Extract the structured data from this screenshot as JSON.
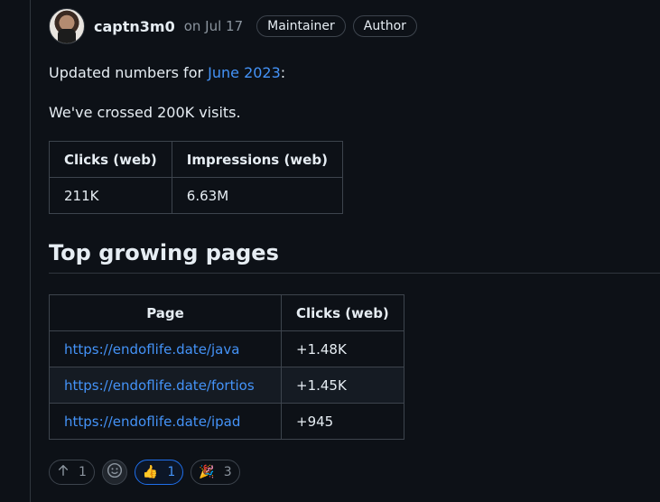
{
  "comment": {
    "author": "captn3m0",
    "date": "on Jul 17",
    "badges": [
      "Maintainer",
      "Author"
    ],
    "intro_prefix": "Updated numbers for ",
    "intro_link": "June 2023",
    "intro_suffix": ":",
    "crossed": "We've crossed 200K visits.",
    "stats": {
      "headers": [
        "Clicks (web)",
        "Impressions (web)"
      ],
      "row": [
        "211K",
        "6.63M"
      ]
    },
    "heading": "Top growing pages",
    "pages": {
      "headers": [
        "Page",
        "Clicks (web)"
      ],
      "rows": [
        [
          "https://endoflife.date/java",
          "+1.48K"
        ],
        [
          "https://endoflife.date/fortios",
          "+1.45K"
        ],
        [
          "https://endoflife.date/ipad",
          "+945"
        ]
      ]
    },
    "reactions": {
      "upvote_count": "1",
      "thumbs_count": "1",
      "tada_count": "3"
    }
  },
  "icons": [
    "arrow-up-icon",
    "smiley-icon",
    "thumbs-up-icon",
    "tada-icon"
  ],
  "colors": {
    "background": "#0d1117",
    "link": "#4493f8",
    "border": "#3d444d"
  }
}
